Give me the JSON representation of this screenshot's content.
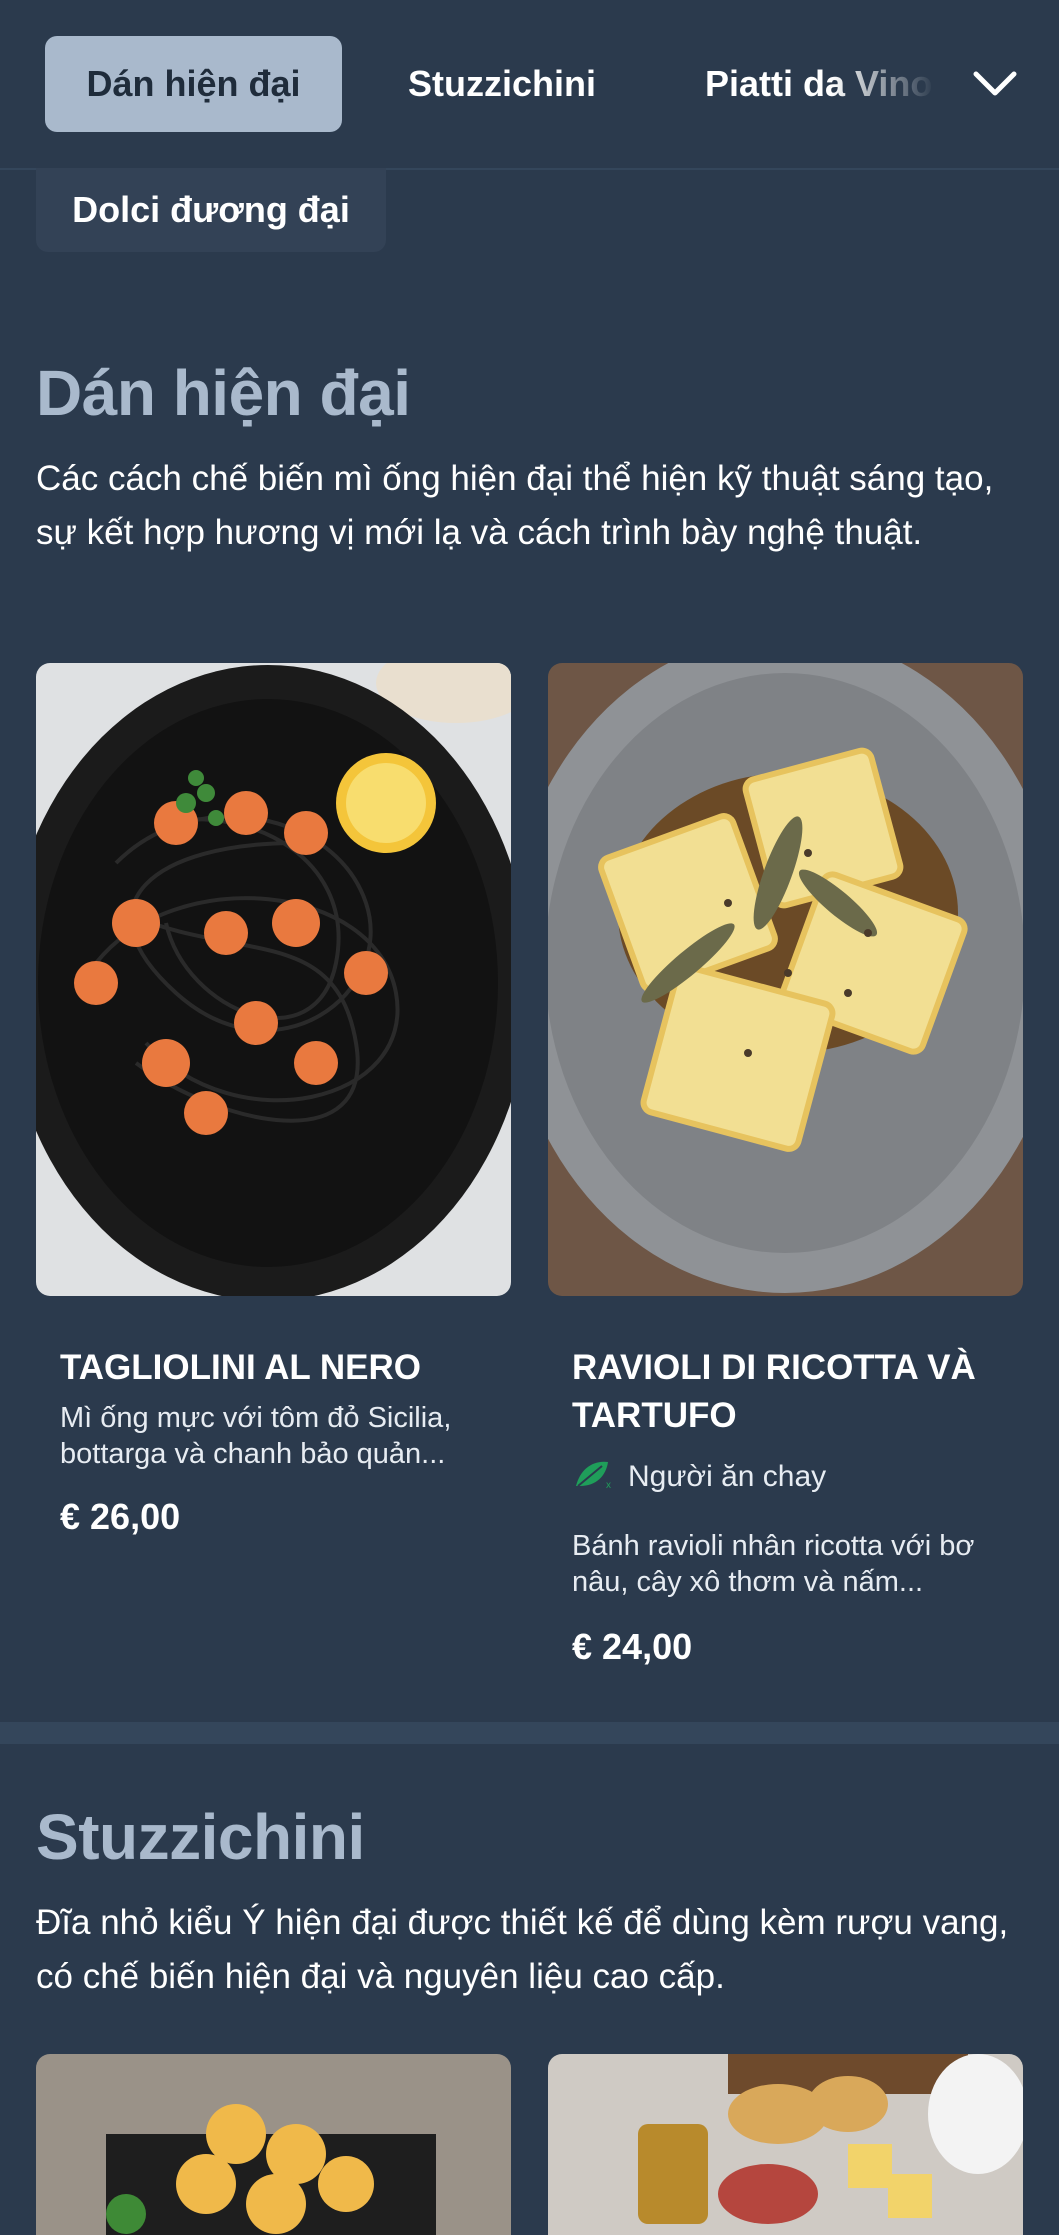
{
  "nav": {
    "tabs": [
      {
        "label": "Dán hiện đại"
      },
      {
        "label": "Stuzzichini"
      },
      {
        "label": "Piatti da Vino"
      },
      {
        "label": "Dolci đương đại"
      }
    ],
    "more_icon": "chevron-down-icon"
  },
  "sections": [
    {
      "title": "Dán hiện đại",
      "description": "Các cách chế biến mì ống hiện đại thể hiện kỹ thuật sáng tạo, sự kết hợp hương vị mới lạ và cách trình bày nghệ thuật.",
      "dishes": [
        {
          "name": "TAGLIOLINI AL NERO",
          "description": "Mì ống mực với tôm đỏ Sicilia, bottarga và chanh bảo quản...",
          "price": "€ 26,00"
        },
        {
          "name": "RAVIOLI DI RICOTTA VÀ TARTUFO",
          "tag": "Người ăn chay",
          "tag_icon": "vegetarian-leaf-icon",
          "description": "Bánh ravioli nhân ricotta với bơ nâu, cây xô thơm và nấm...",
          "price": "€ 24,00"
        }
      ]
    },
    {
      "title": "Stuzzichini",
      "description": "Đĩa nhỏ kiểu Ý hiện đại được thiết kế để dùng kèm rượu vang, có chế biến hiện đại và nguyên liệu cao cấp."
    }
  ],
  "colors": {
    "background": "#2b3a4d",
    "active_tab": "#a9b9cc",
    "section_title": "#a9b9cc",
    "veg_tag": "#1f9e5a"
  }
}
